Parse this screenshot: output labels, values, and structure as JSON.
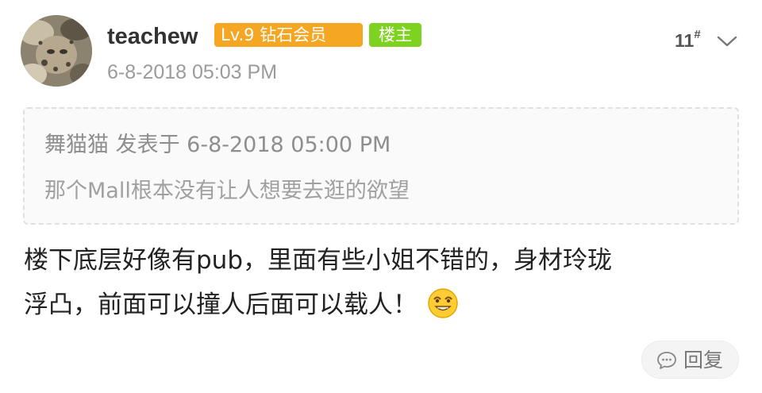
{
  "post": {
    "author": {
      "username": "teachew",
      "level_badge": "Lv.9 钻石会员",
      "op_badge": "楼主",
      "avatar_icon": "cat-avatar"
    },
    "timestamp": "6-8-2018 05:03 PM",
    "floor": {
      "number": "11",
      "symbol": "#"
    },
    "quote": {
      "header": "舞猫猫 发表于 6-8-2018 05:00 PM",
      "text": "那个Mall根本没有让人想要去逛的欲望"
    },
    "content": {
      "line1": "楼下底层好像有pub，里面有些小姐不错的，身材玲珑",
      "line2": "浮凸，前面可以撞人后面可以载人！",
      "emoji_icon": "grinning-face-emoji"
    },
    "reply_button": {
      "label": "回复",
      "icon": "comment-bubble-icon"
    }
  },
  "colors": {
    "level_badge": "#f5a623",
    "op_badge": "#7ed321",
    "muted_text": "#9b9b9b",
    "body_text": "#222222"
  }
}
